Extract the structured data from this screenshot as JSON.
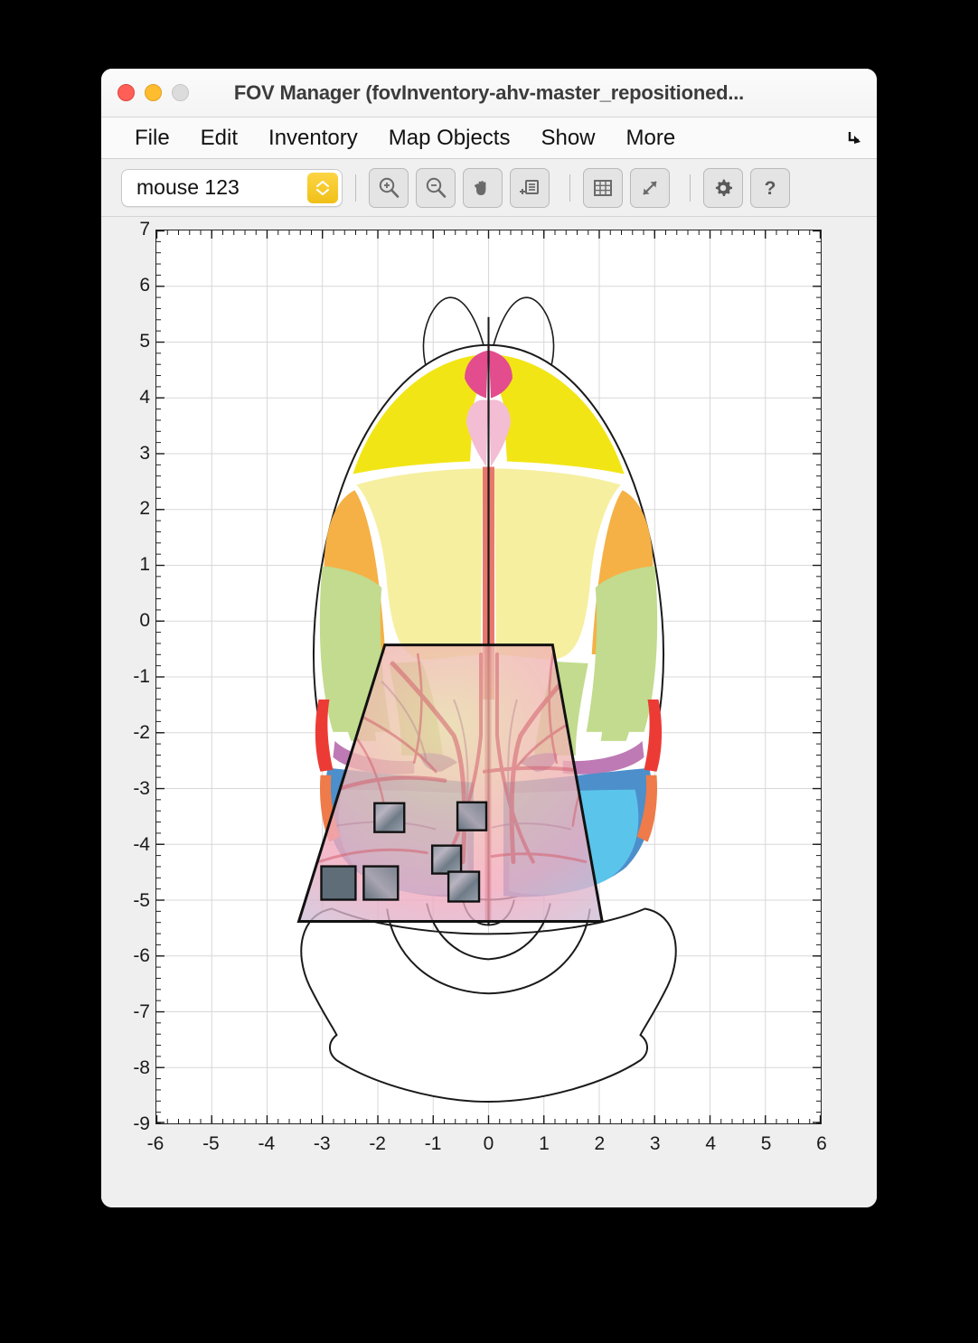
{
  "window": {
    "title": "FOV Manager (fovInventory-ahv-master_repositioned...",
    "traffic_lights": [
      "close",
      "minimize",
      "zoom"
    ]
  },
  "menubar": {
    "items": [
      {
        "label": "File"
      },
      {
        "label": "Edit"
      },
      {
        "label": "Inventory"
      },
      {
        "label": "Map Objects"
      },
      {
        "label": "Show"
      },
      {
        "label": "More"
      }
    ],
    "overflow_icon": "arrow-down-right-icon"
  },
  "toolbar": {
    "mouse_select": {
      "value": "mouse 123",
      "stepper_icon": "up-down-chevron-icon"
    },
    "buttons": [
      {
        "name": "zoom-in-button",
        "icon": "magnifier-plus-icon"
      },
      {
        "name": "zoom-out-button",
        "icon": "magnifier-minus-icon"
      },
      {
        "name": "pan-button",
        "icon": "hand-icon"
      },
      {
        "name": "add-annotation-button",
        "icon": "document-plus-icon"
      },
      {
        "name": "grid-toggle-button",
        "icon": "grid-icon"
      },
      {
        "name": "fit-view-button",
        "icon": "expand-diagonal-icon"
      },
      {
        "name": "settings-button",
        "icon": "gear-icon"
      },
      {
        "name": "help-button",
        "icon": "question-mark-icon"
      }
    ]
  },
  "chart_data": {
    "type": "map",
    "title": "",
    "xlabel": "",
    "ylabel": "",
    "xlim": [
      -6,
      6
    ],
    "ylim": [
      -9,
      7
    ],
    "xticks": [
      -6,
      -5,
      -4,
      -3,
      -2,
      -1,
      0,
      1,
      2,
      3,
      4,
      5,
      6
    ],
    "yticks": [
      7,
      6,
      5,
      4,
      3,
      2,
      1,
      0,
      -1,
      -2,
      -3,
      -4,
      -5,
      -6,
      -7,
      -8,
      -9
    ],
    "grid": true,
    "minor_ticks_per_major": 5,
    "description": "Dorsal-view mouse brain cortical area atlas with cranial-window photo overlay and FOV rectangles",
    "region_colors": {
      "bright_yellow": "#F2E516",
      "pale_yellow": "#F6EFA0",
      "orange": "#F5B145",
      "light_green": "#C2DB8E",
      "magenta": "#E34C8D",
      "pink": "#F3BDD3",
      "salmon": "#E8776B",
      "light_blue": "#5BC4EA",
      "medium_blue": "#4C8FCB",
      "purple": "#7B4FA5",
      "mauve": "#BE7AB4",
      "red": "#EC3B35",
      "orange_red": "#EE7B49"
    },
    "fov_rectangles": [
      {
        "id": 1,
        "x": -2.05,
        "y": -2.79,
        "w": 0.43,
        "h": 0.43
      },
      {
        "id": 2,
        "x": -0.55,
        "y": -2.78,
        "w": 0.42,
        "h": 0.42
      },
      {
        "id": 3,
        "x": -1.0,
        "y": -3.55,
        "w": 0.42,
        "h": 0.42
      },
      {
        "id": 4,
        "x": -3.01,
        "y": -3.93,
        "w": 0.5,
        "h": 0.48
      },
      {
        "id": 5,
        "x": -2.24,
        "y": -3.92,
        "w": 0.5,
        "h": 0.48
      },
      {
        "id": 6,
        "x": -0.72,
        "y": -4.02,
        "w": 0.44,
        "h": 0.44
      }
    ],
    "window_trapezoid": {
      "top_left": [
        -1.88,
        0.63
      ],
      "top_right": [
        1.15,
        0.63
      ],
      "bottom_right": [
        2.05,
        -4.32
      ],
      "bottom_left": [
        -3.42,
        -4.32
      ]
    }
  }
}
